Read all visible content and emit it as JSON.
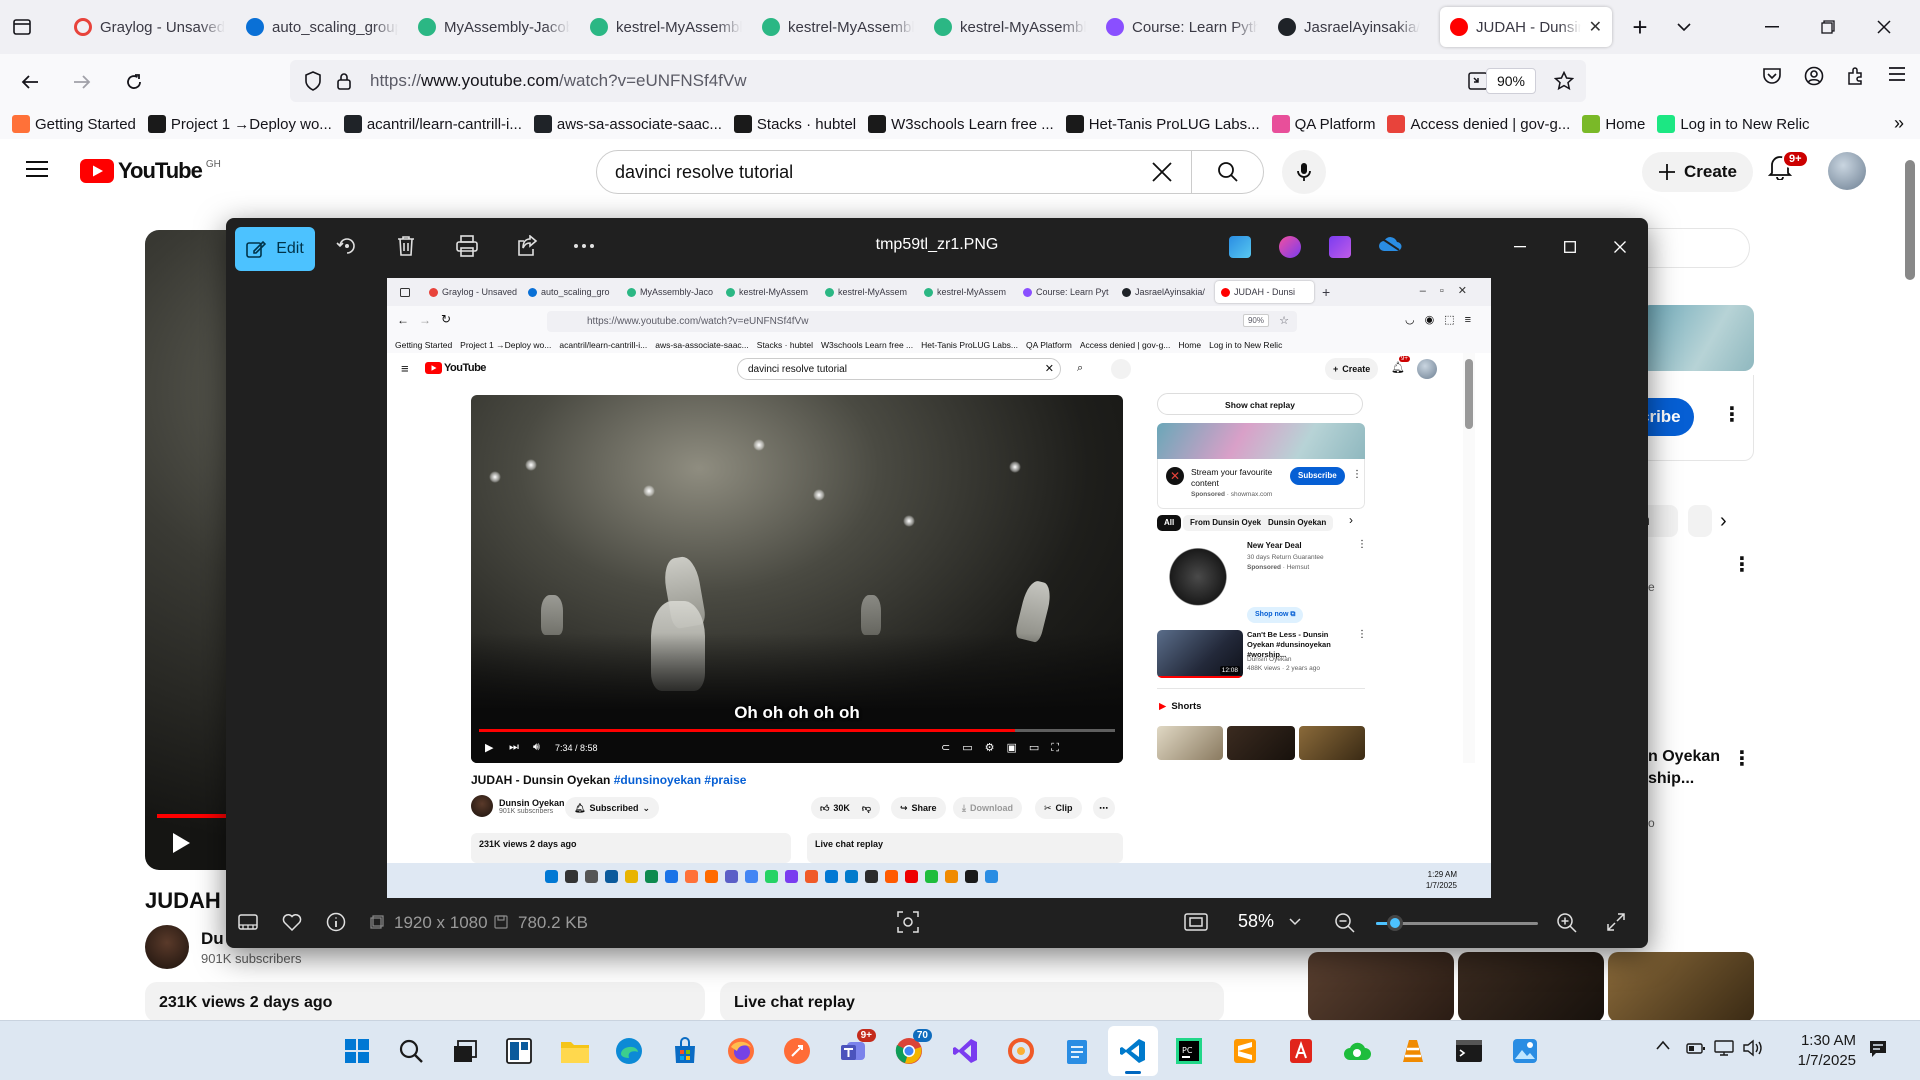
{
  "browser": {
    "tabs": [
      {
        "label": "Graylog - Unsaved",
        "color": "#e8433b",
        "ring": true
      },
      {
        "label": "auto_scaling_group",
        "color": "#0a70d6",
        "ring": false
      },
      {
        "label": "MyAssembly-Jacob",
        "color": "#2bb784",
        "ring": false
      },
      {
        "label": "kestrel-MyAssembly",
        "color": "#2bb784",
        "ring": false
      },
      {
        "label": "kestrel-MyAssembly",
        "color": "#2bb784",
        "ring": false
      },
      {
        "label": "kestrel-MyAssembly",
        "color": "#2bb784",
        "ring": false
      },
      {
        "label": "Course: Learn Python",
        "color": "#8a4fff",
        "ring": false
      },
      {
        "label": "JasraelAyinsakia/",
        "color": "#1f2328",
        "ring": false
      },
      {
        "label": "JUDAH - Dunsin",
        "color": "#ff0000",
        "ring": false
      }
    ],
    "url_prefix": "https://",
    "url_host": "www.youtube.com",
    "url_path": "/watch?v=eUNFNSf4fVw",
    "zoom": "90%",
    "bookmarks": [
      {
        "label": "Getting Started",
        "color": "#ff7139"
      },
      {
        "label": "Project 1 →Deploy wo...",
        "color": "#1a1a1a"
      },
      {
        "label": "acantril/learn-cantrill-i...",
        "color": "#1f2328"
      },
      {
        "label": "aws-sa-associate-saac...",
        "color": "#1f2328"
      },
      {
        "label": "Stacks · hubtel",
        "color": "#1a1a1a"
      },
      {
        "label": "W3schools Learn free ...",
        "color": "#1a1a1a"
      },
      {
        "label": "Het-Tanis ProLUG Labs...",
        "color": "#1a1a1a"
      },
      {
        "label": "QA Platform",
        "color": "#e84f9a"
      },
      {
        "label": "Access denied | gov-g...",
        "color": "#e8433b"
      },
      {
        "label": "Home",
        "color": "#7ab928"
      },
      {
        "label": "Log in to New Relic",
        "color": "#1ce783"
      }
    ]
  },
  "youtube": {
    "logo_text": "YouTube",
    "country_code": "GH",
    "search_query": "davinci resolve tutorial",
    "create_label": "Create",
    "notif_count": "9+",
    "bg_title": "JUDAH -",
    "bg_channel_prefix": "Du",
    "bg_subscribers": "901K subscribers",
    "bg_views": "231K views  2 days ago",
    "bg_live_chat": "Live chat replay",
    "side_subscribe": "cribe",
    "side_chip": "n",
    "side_video_title_1": "n Oyekan",
    "side_video_title_2": "ship...",
    "side_views_fragment": "o",
    "side_e_fragment": "e",
    "bg_underlay_fragments": [
      "Subscribed",
      "30K",
      "Share",
      "Download",
      "Clip"
    ]
  },
  "viewer": {
    "edit_label": "Edit",
    "file_name": "tmp59tl_zr1.PNG",
    "dimensions": "1920 x 1080",
    "file_size": "780.2 KB",
    "zoom": "58%",
    "zoom_fraction": 0.12
  },
  "inner": {
    "tabs": [
      "Graylog - Unsaved",
      "auto_scaling_gro",
      "MyAssembly-Jaco",
      "kestrel-MyAssem",
      "kestrel-MyAssem",
      "kestrel-MyAssem",
      "Course: Learn Pyt",
      "JasraelAyinsakia/",
      "JUDAH - Dunsi"
    ],
    "url": "https://www.youtube.com/watch?v=eUNFNSf4fVw",
    "zoom": "90%",
    "bookmarks": [
      "Getting Started",
      "Project 1 →Deploy wo...",
      "acantril/learn-cantrill-i...",
      "aws-sa-associate-saac...",
      "Stacks · hubtel",
      "W3schools Learn free ...",
      "Het-Tanis ProLUG Labs...",
      "QA Platform",
      "Access denied | gov-g...",
      "Home",
      "Log in to New Relic"
    ],
    "search_query": "davinci resolve tutorial",
    "create_label": "Create",
    "notif_count": "9+",
    "caption": "Oh oh oh oh oh",
    "time": "7:34 / 8:58",
    "progress": 0.843,
    "title_plain": "JUDAH - Dunsin Oyekan ",
    "title_tags": "#dunsinoyekan #praise",
    "channel": "Dunsin Oyekan",
    "subscribers": "901K subscribers",
    "subscribed_label": "Subscribed",
    "likes": "30K",
    "share_label": "Share",
    "download_label": "Download",
    "clip_label": "Clip",
    "views": "231K views  2 days ago",
    "live_chat": "Live chat replay",
    "show_chat": "Show chat replay",
    "ad_title": "Stream your favourite content",
    "ad_sponsored": "Sponsored",
    "ad_domain": "· showmax.com",
    "ad_subscribe": "Subscribe",
    "chips": [
      "All",
      "From Dunsin Oyekan",
      "Dunsin Oyekan"
    ],
    "deal_title": "New Year Deal",
    "deal_sub": "30 days Return Guarantee",
    "deal_sponsored": "Sponsored",
    "deal_brand": "· Hemsut",
    "shop_now": "Shop now",
    "rec_title": "Can't Be Less - Dunsin Oyekan #dunsinoyekan #worship...",
    "rec_channel": "Dunsin Oyekan",
    "rec_meta": "488K views · 2 years ago",
    "rec_duration": "12:08",
    "shorts_label": "Shorts",
    "clock_time": "1:29 AM",
    "clock_date": "1/7/2025"
  },
  "taskbar": {
    "time": "1:30 AM",
    "date": "1/7/2025",
    "teams_badge": "9+",
    "chrome_badge": "70"
  }
}
